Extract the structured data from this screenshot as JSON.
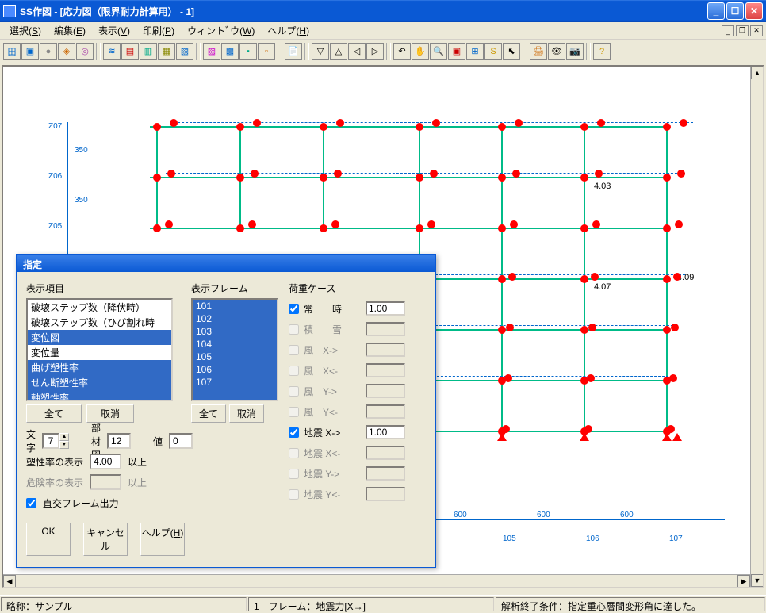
{
  "window": {
    "title": "SS作図 - [応力図（限界耐力計算用） - 1]"
  },
  "menu": {
    "items": [
      "選択(S)",
      "編集(E)",
      "表示(V)",
      "印刷(P)",
      "ウィントﾞウ(W)",
      "ヘルプ(H)"
    ]
  },
  "canvas": {
    "z_labels": [
      "Z07",
      "Z06",
      "Z05"
    ],
    "x_labels": [
      "105",
      "106",
      "107"
    ],
    "dims_v": [
      "350",
      "350"
    ],
    "dims_h": [
      "600",
      "600",
      "600"
    ],
    "annotations": {
      "a1": "4.03",
      "a2": "4.07",
      "a3": "4.09"
    }
  },
  "dialog": {
    "title": "指定",
    "col1": {
      "label": "表示項目",
      "options": [
        "破壊ステップ数（降伏時）",
        "破壊ステップ数（ひび割れ時",
        "変位図",
        "変位量",
        "曲げ塑性率",
        "せん断塑性率",
        "軸塑性率"
      ],
      "btn_all": "全て",
      "btn_cancel": "取消"
    },
    "col2": {
      "label": "表示フレーム",
      "options": [
        "101",
        "102",
        "103",
        "104",
        "105",
        "106",
        "107"
      ],
      "btn_all": "全て",
      "btn_cancel": "取消"
    },
    "controls": {
      "moji_label": "文字",
      "moji_val": "7",
      "buzai_label": "部材図",
      "buzai_val": "12",
      "val_label": "値",
      "val_val": "0",
      "sosei_label": "塑性率の表示",
      "sosei_val": "4.00",
      "ijo": "以上",
      "kiken_label": "危険率の表示",
      "kiken_val": "",
      "ortho_label": "直交フレーム出力"
    },
    "loadcases": {
      "label": "荷重ケース",
      "rows": [
        {
          "lab": "常　　時",
          "val": "1.00",
          "en": true
        },
        {
          "lab": "積　　雪",
          "val": "",
          "en": false
        },
        {
          "lab": "風　X->",
          "val": "",
          "en": false
        },
        {
          "lab": "風　X<-",
          "val": "",
          "en": false
        },
        {
          "lab": "風　Y->",
          "val": "",
          "en": false
        },
        {
          "lab": "風　Y<-",
          "val": "",
          "en": false
        },
        {
          "lab": "地震 X->",
          "val": "1.00",
          "en": true
        },
        {
          "lab": "地震 X<-",
          "val": "",
          "en": false
        },
        {
          "lab": "地震 Y->",
          "val": "",
          "en": false
        },
        {
          "lab": "地震 Y<-",
          "val": "",
          "en": false
        }
      ]
    },
    "buttons": {
      "ok": "OK",
      "cancel": "キャンセル",
      "help": "ヘルプ(H)"
    }
  },
  "status": {
    "p1": "略称：サンプル",
    "p2": "1　フレーム：地震力[X→]",
    "p3": "解析終了条件：指定重心層間変形角に達した。"
  }
}
